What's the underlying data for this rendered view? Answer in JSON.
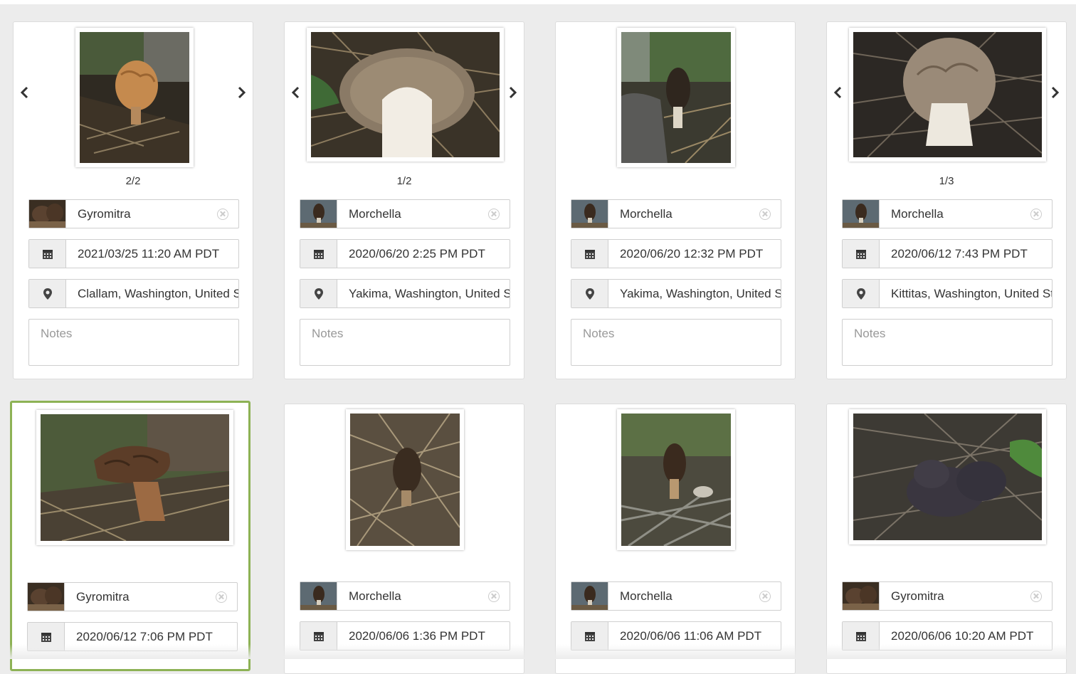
{
  "cards": [
    {
      "species": "Gyromitra",
      "date": "2021/03/25 11:20 AM PDT",
      "location": "Clallam, Washington, United States",
      "notes_placeholder": "Notes",
      "counter": "2/2"
    },
    {
      "species": "Morchella",
      "date": "2020/06/20 2:25 PM PDT",
      "location": "Yakima, Washington, United States",
      "notes_placeholder": "Notes",
      "counter": "1/2"
    },
    {
      "species": "Morchella",
      "date": "2020/06/20 12:32 PM PDT",
      "location": "Yakima, Washington, United States",
      "notes_placeholder": "Notes",
      "counter": ""
    },
    {
      "species": "Morchella",
      "date": "2020/06/12 7:43 PM PDT",
      "location": "Kittitas, Washington, United States",
      "notes_placeholder": "Notes",
      "counter": "1/3"
    },
    {
      "species": "Gyromitra",
      "date": "2020/06/12 7:06 PM PDT"
    },
    {
      "species": "Morchella",
      "date": "2020/06/06 1:36 PM PDT"
    },
    {
      "species": "Morchella",
      "date": "2020/06/06 11:06 AM PDT"
    },
    {
      "species": "Gyromitra",
      "date": "2020/06/06 10:20 AM PDT"
    }
  ],
  "icons": {
    "prev": "chevron-left-icon",
    "next": "chevron-right-icon",
    "calendar": "calendar-icon",
    "location": "map-pin-icon",
    "clear": "clear-circle-icon"
  },
  "colors": {
    "selected_border": "#8db255",
    "background": "#ececec"
  }
}
